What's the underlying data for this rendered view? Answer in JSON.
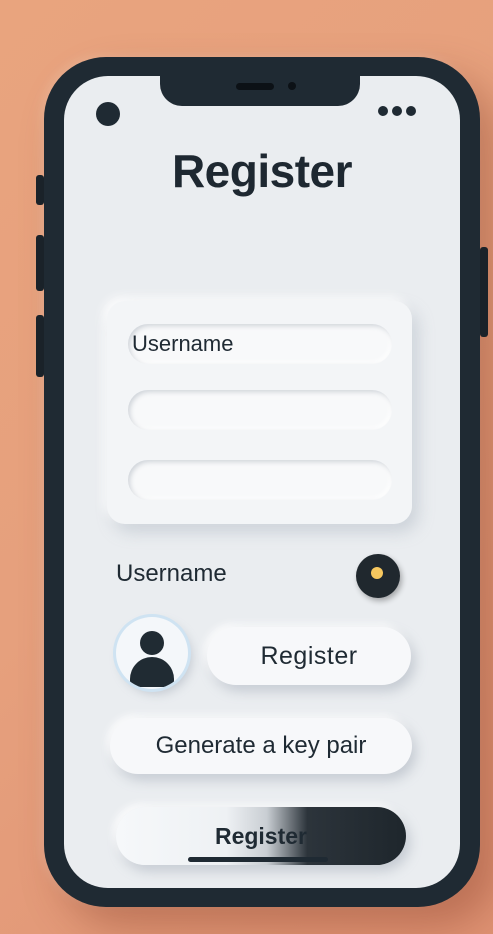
{
  "screen": {
    "title": "Register"
  },
  "form_card": {
    "fields": [
      {
        "value": "Username"
      },
      {
        "value": ""
      },
      {
        "value": ""
      }
    ]
  },
  "username_row": {
    "label": "Username"
  },
  "actions": {
    "register_label": "Register",
    "generate_key_label": "Generate a key pair",
    "primary_register_label": "Register"
  },
  "icons": {
    "avatar": "user-avatar-icon",
    "status": "status-dot-icon",
    "more": "more-dots-icon",
    "toggle": "toggle-knob-icon"
  },
  "colors": {
    "background": "#e6a07d",
    "phone_frame": "#1f2a33",
    "screen": "#eaedf0",
    "toggle_accent": "#f7c85f"
  }
}
